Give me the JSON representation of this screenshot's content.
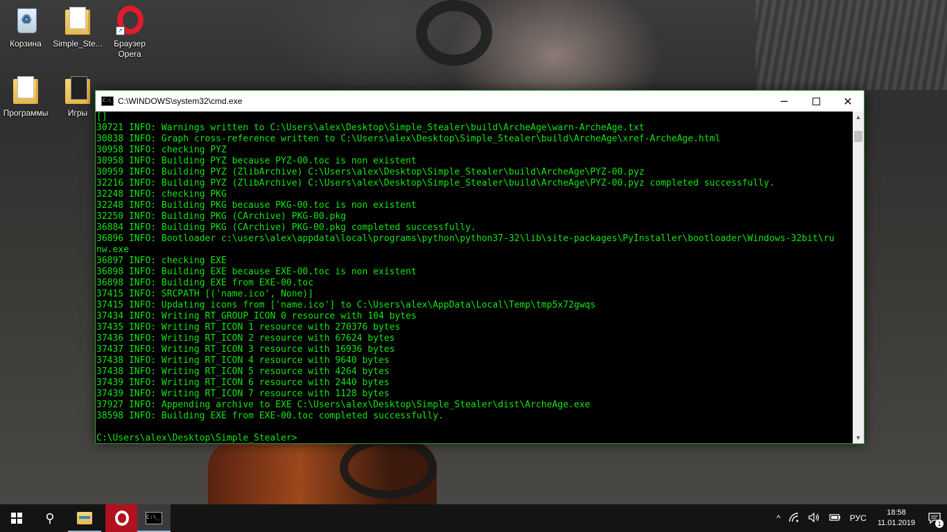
{
  "desktop": {
    "icons": [
      {
        "label": "Корзина",
        "icon": "recycle-bin-icon"
      },
      {
        "label": "Simple_Ste...",
        "icon": "folder-icon"
      },
      {
        "label": "Браузер Opera",
        "icon": "opera-icon"
      },
      {
        "label": "Программы",
        "icon": "folder-icon"
      },
      {
        "label": "Игры",
        "icon": "folder-icon"
      }
    ]
  },
  "window": {
    "title": "C:\\WINDOWS\\system32\\cmd.exe",
    "icon": "cmd-icon",
    "controls": {
      "minimize": "─",
      "close": "✕"
    },
    "border_color": "#37a33d"
  },
  "console": {
    "text_color": "#13e613",
    "lines": [
      "[]",
      "30721 INFO: Warnings written to C:\\Users\\alex\\Desktop\\Simple_Stealer\\build\\ArcheAge\\warn-ArcheAge.txt",
      "30838 INFO: Graph cross-reference written to C:\\Users\\alex\\Desktop\\Simple_Stealer\\build\\ArcheAge\\xref-ArcheAge.html",
      "30958 INFO: checking PYZ",
      "30958 INFO: Building PYZ because PYZ-00.toc is non existent",
      "30959 INFO: Building PYZ (ZlibArchive) C:\\Users\\alex\\Desktop\\Simple_Stealer\\build\\ArcheAge\\PYZ-00.pyz",
      "32216 INFO: Building PYZ (ZlibArchive) C:\\Users\\alex\\Desktop\\Simple_Stealer\\build\\ArcheAge\\PYZ-00.pyz completed successfully.",
      "32248 INFO: checking PKG",
      "32248 INFO: Building PKG because PKG-00.toc is non existent",
      "32250 INFO: Building PKG (CArchive) PKG-00.pkg",
      "36884 INFO: Building PKG (CArchive) PKG-00.pkg completed successfully.",
      "36896 INFO: Bootloader c:\\users\\alex\\appdata\\local\\programs\\python\\python37-32\\lib\\site-packages\\PyInstaller\\bootloader\\Windows-32bit\\ru",
      "nw.exe",
      "36897 INFO: checking EXE",
      "36898 INFO: Building EXE because EXE-00.toc is non existent",
      "36898 INFO: Building EXE from EXE-00.toc",
      "37415 INFO: SRCPATH [('name.ico', None)]",
      "37415 INFO: Updating icons from ['name.ico'] to C:\\Users\\alex\\AppData\\Local\\Temp\\tmp5x72gwqs",
      "37434 INFO: Writing RT_GROUP_ICON 0 resource with 104 bytes",
      "37435 INFO: Writing RT_ICON 1 resource with 270376 bytes",
      "37436 INFO: Writing RT_ICON 2 resource with 67624 bytes",
      "37437 INFO: Writing RT_ICON 3 resource with 16936 bytes",
      "37438 INFO: Writing RT_ICON 4 resource with 9640 bytes",
      "37438 INFO: Writing RT_ICON 5 resource with 4264 bytes",
      "37439 INFO: Writing RT_ICON 6 resource with 2440 bytes",
      "37439 INFO: Writing RT_ICON 7 resource with 1128 bytes",
      "37927 INFO: Appending archive to EXE C:\\Users\\alex\\Desktop\\Simple_Stealer\\dist\\ArcheAge.exe",
      "38598 INFO: Building EXE from EXE-00.toc completed successfully.",
      "",
      "C:\\Users\\alex\\Desktop\\Simple_Stealer>"
    ]
  },
  "scrollbar": {
    "up": "▲",
    "down": "▼"
  },
  "taskbar": {
    "start_icon": "windows-start-icon",
    "search_glyph": "⚲",
    "apps": [
      {
        "name": "file-explorer",
        "icon": "folder-icon"
      },
      {
        "name": "opera",
        "icon": "opera-icon"
      },
      {
        "name": "cmd",
        "icon": "cmd-icon",
        "active": true
      }
    ],
    "tray": {
      "chevron": "^",
      "language": "РУС",
      "time": "18:58",
      "date": "11.01.2019",
      "notification_count": "1"
    }
  }
}
